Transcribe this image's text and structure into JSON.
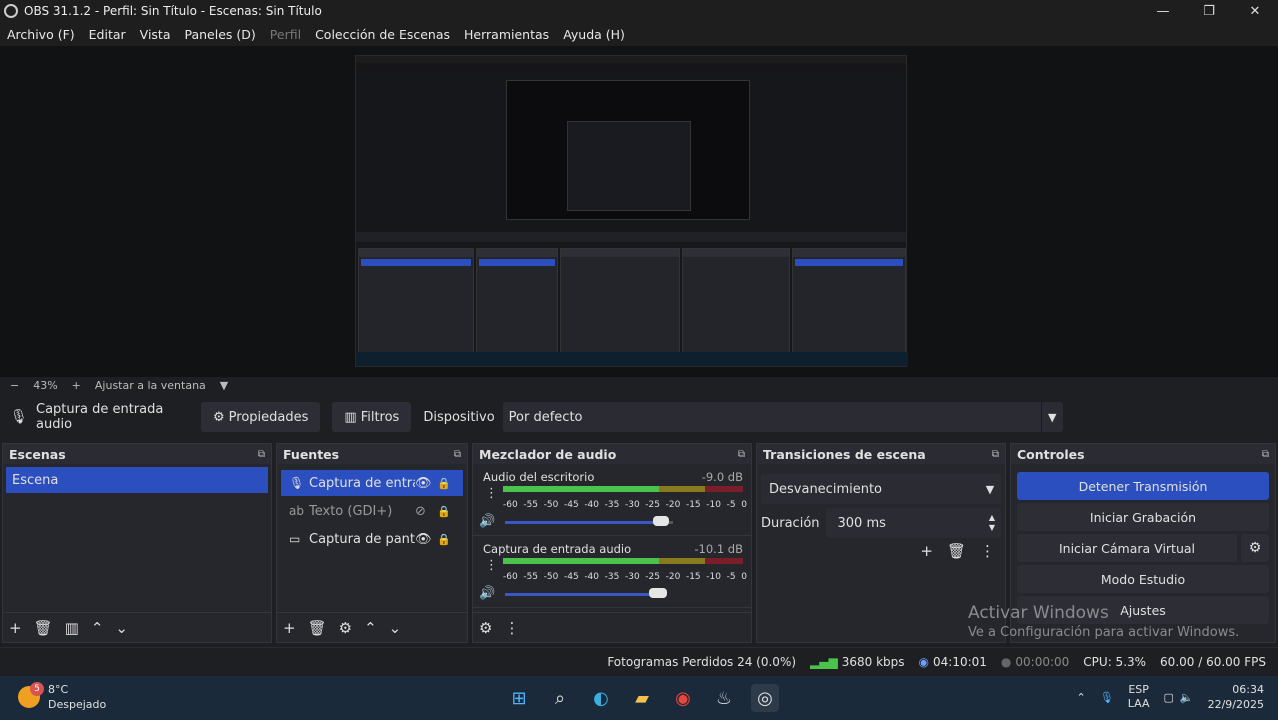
{
  "window": {
    "title": "OBS 31.1.2 - Perfil: Sin Título - Escenas: Sin Título"
  },
  "menu": [
    "Archivo (F)",
    "Editar",
    "Vista",
    "Paneles (D)",
    "Perfil",
    "Colección de Escenas",
    "Herramientas",
    "Ayuda (H)"
  ],
  "zoom": {
    "minus": "−",
    "level": "43%",
    "plus": "+",
    "fit": "Ajustar a la ventana",
    "arrow": "▼"
  },
  "source_toolbar": {
    "source_name": "Captura de entrada audio",
    "properties_label": "Propiedades",
    "filters_label": "Filtros",
    "device_label": "Dispositivo",
    "device_value": "Por defecto"
  },
  "docks": {
    "scenes": {
      "title": "Escenas",
      "items": [
        "Escena"
      ]
    },
    "sources": {
      "title": "Fuentes",
      "items": [
        {
          "label": "Captura de entrada audio",
          "icon": "mic-icon"
        },
        {
          "label": "Texto (GDI+)",
          "icon": "text-icon"
        },
        {
          "label": "Captura de pantalla",
          "icon": "monitor-icon"
        }
      ]
    },
    "mixer": {
      "title": "Mezclador de audio",
      "channels": [
        {
          "name": "Audio del escritorio",
          "db": "-9.0 dB",
          "level": 0.86
        },
        {
          "name": "Captura de entrada audio",
          "db": "-10.1 dB",
          "level": 0.84
        }
      ],
      "scale": [
        "-60",
        "-55",
        "-50",
        "-45",
        "-40",
        "-35",
        "-30",
        "-25",
        "-20",
        "-15",
        "-10",
        "-5",
        "0"
      ]
    },
    "transitions": {
      "title": "Transiciones de escena",
      "type": "Desvanecimiento",
      "duration_label": "Duración",
      "duration": "300 ms"
    },
    "controls": {
      "title": "Controles",
      "stop_stream": "Detener Transmisión",
      "start_record": "Iniciar Grabación",
      "virtual_cam": "Iniciar Cámara Virtual",
      "studio_mode": "Modo Estudio",
      "settings": "Ajustes"
    }
  },
  "watermark": {
    "line1": "Activar Windows",
    "line2": "Ve a Configuración para activar Windows."
  },
  "status": {
    "dropped": "Fotogramas Perdidos 24 (0.0%)",
    "bitrate": "3680 kbps",
    "stream_time": "04:10:01",
    "rec_time": "00:00:00",
    "cpu": "CPU: 5.3%",
    "fps": "60.00 / 60.00 FPS"
  },
  "taskbar": {
    "weather_temp": "8°C",
    "weather_desc": "Despejado",
    "weather_badge": "5",
    "lang1": "ESP",
    "lang2": "LAA",
    "time": "06:34",
    "date": "22/9/2025"
  },
  "colors": {
    "accent": "#2c4fbf",
    "panel": "#26272d",
    "background": "#1e1f22"
  }
}
